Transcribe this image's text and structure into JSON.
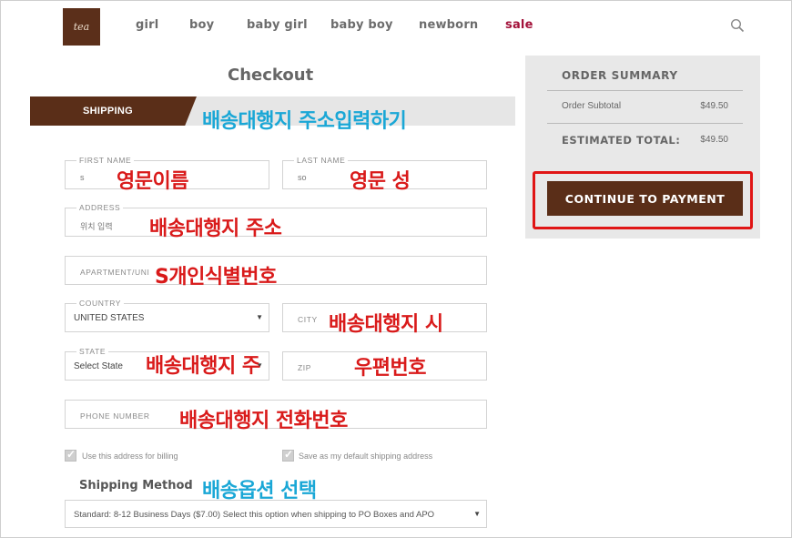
{
  "header": {
    "logo_text": "tea",
    "nav": [
      "girl",
      "boy",
      "baby girl",
      "baby boy",
      "newborn",
      "sale"
    ]
  },
  "checkout": {
    "title": "Checkout",
    "shipping_tab": "SHIPPING",
    "shipping_annotation": "배송대행지 주소입력하기"
  },
  "form": {
    "first_name": {
      "label": "FIRST NAME",
      "value": "s",
      "annotation": "영문이름"
    },
    "last_name": {
      "label": "LAST NAME",
      "value": "so",
      "annotation": "영문 성"
    },
    "address": {
      "label": "ADDRESS",
      "value": "위치 입력",
      "annotation": "배송대행지 주소"
    },
    "apartment": {
      "placeholder": "APARTMENT/UNI",
      "annotation": "S개인식별번호"
    },
    "country": {
      "label": "COUNTRY",
      "value": "UNITED STATES"
    },
    "city": {
      "placeholder": "CITY",
      "annotation": "배송대행지 시"
    },
    "state": {
      "label": "STATE",
      "value": "Select State",
      "annotation": "배송대행지 주"
    },
    "zip": {
      "placeholder": "ZIP",
      "annotation": "우편번호"
    },
    "phone": {
      "placeholder": "PHONE NUMBER",
      "annotation": "배송대행지 전화번호"
    },
    "billing_checkbox": "Use this address for billing",
    "default_checkbox": "Save as my default shipping address",
    "shipping_method_label": "Shipping Method",
    "shipping_method_annotation": "배송옵션 선택",
    "shipping_method_value": "Standard: 8-12 Business Days ($7.00) Select this option when shipping to PO Boxes and APO"
  },
  "summary": {
    "title": "ORDER SUMMARY",
    "subtotal_label": "Order Subtotal",
    "subtotal_value": "$49.50",
    "total_label": "ESTIMATED TOTAL:",
    "total_value": "$49.50",
    "pay_button": "CONTINUE TO PAYMENT"
  },
  "colors": {
    "brand_brown": "#5a2e18",
    "sale_red": "#a3123a",
    "annotation_red": "#d91a1a",
    "annotation_cyan": "#1aa7d6",
    "highlight_outline": "#e01515"
  }
}
